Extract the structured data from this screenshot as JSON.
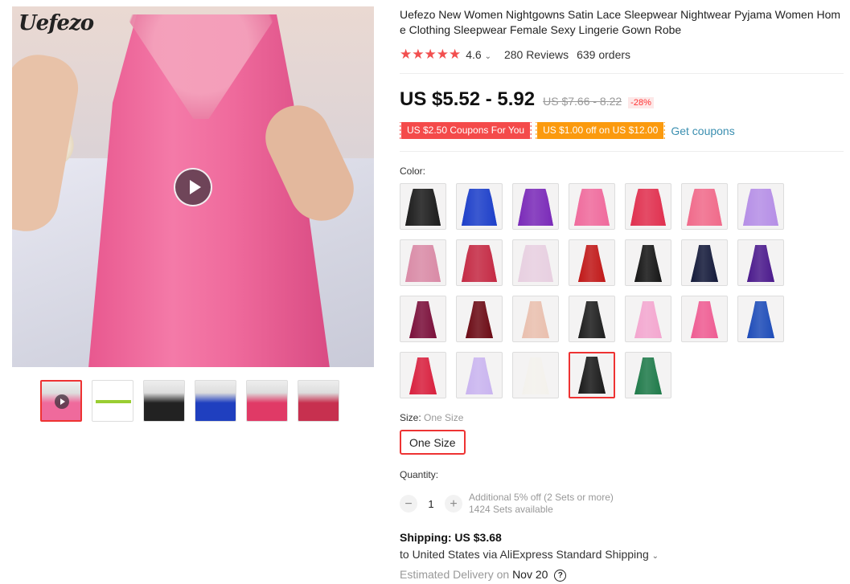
{
  "gallery": {
    "brand_logo": "Uefezo",
    "thumbnails": [
      {
        "color": "#ef6a9c",
        "has_video": true
      },
      {
        "color": "#ffffff",
        "has_video": false
      },
      {
        "color": "#222222",
        "has_video": false
      },
      {
        "color": "#1f3fbf",
        "has_video": false
      },
      {
        "color": "#e03a66",
        "has_video": false
      },
      {
        "color": "#c7304f",
        "has_video": false
      }
    ]
  },
  "product": {
    "title": "Uefezo New Women Nightgowns Satin Lace Sleepwear Nightwear Pyjama Women Home Clothing Sleepwear Female Sexy Lingerie Gown Robe",
    "stars": "★★★★★",
    "rating": "4.6",
    "reviews": "280 Reviews",
    "orders": "639 orders"
  },
  "price": {
    "current": "US $5.52 - 5.92",
    "original": "US $7.66 - 8.22",
    "discount": "-28%"
  },
  "coupons": {
    "items": [
      "US $2.50 Coupons For You",
      "US $1.00 off on US $12.00"
    ],
    "link": "Get coupons"
  },
  "color": {
    "label": "Color:",
    "swatches": [
      {
        "color": "#1c1c1c",
        "style": "wide"
      },
      {
        "color": "#1d3fc9",
        "style": "wide"
      },
      {
        "color": "#7a2ab8",
        "style": "wide"
      },
      {
        "color": "#ef6a9c",
        "style": "wide"
      },
      {
        "color": "#e0304f",
        "style": "wide"
      },
      {
        "color": "#f06a8a",
        "style": "wide"
      },
      {
        "color": "#b58ee6",
        "style": "wide"
      },
      {
        "color": "#d98aa6",
        "style": "wide"
      },
      {
        "color": "#c42a44",
        "style": "wide"
      },
      {
        "color": "#e7cfe0",
        "style": "wide"
      },
      {
        "color": "#c01818",
        "style": "slim"
      },
      {
        "color": "#161616",
        "style": "slim"
      },
      {
        "color": "#141a3a",
        "style": "slim"
      },
      {
        "color": "#4b1a8c",
        "style": "slim"
      },
      {
        "color": "#7a0f3a",
        "style": "slim"
      },
      {
        "color": "#6b0a14",
        "style": "slim"
      },
      {
        "color": "#e9bfae",
        "style": "slim"
      },
      {
        "color": "#1e1e1e",
        "style": "slim"
      },
      {
        "color": "#f3a6cf",
        "style": "slim"
      },
      {
        "color": "#ee5c92",
        "style": "slim"
      },
      {
        "color": "#1e4cb8",
        "style": "slim"
      },
      {
        "color": "#d8203e",
        "style": "slim"
      },
      {
        "color": "#c9b4ef",
        "style": "slim"
      },
      {
        "color": "#f3f1ec",
        "style": "slim"
      },
      {
        "color": "#1a1a1a",
        "style": "slim",
        "selected": true
      },
      {
        "color": "#1f7a4a",
        "style": "slim"
      }
    ]
  },
  "size": {
    "label": "Size:",
    "selected_value": "One Size",
    "option": "One Size"
  },
  "quantity": {
    "label": "Quantity:",
    "minus": "−",
    "value": "1",
    "plus": "+",
    "note_line1": "Additional 5% off (2 Sets or more)",
    "note_line2": "1424 Sets available"
  },
  "shipping": {
    "title": "Shipping: US $3.68",
    "destination": "to United States via AliExpress Standard Shipping",
    "delivery_prefix": "Estimated Delivery on",
    "delivery_date": "Nov 20",
    "help": "?"
  }
}
